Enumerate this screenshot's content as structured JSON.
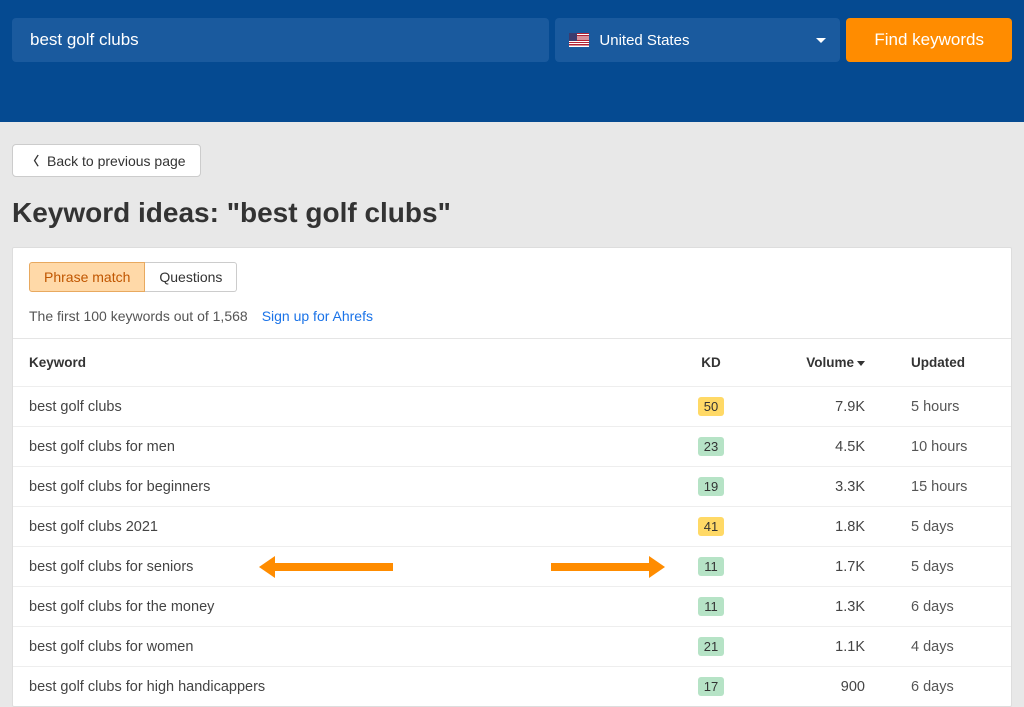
{
  "header": {
    "search_value": "best golf clubs",
    "country": "United States",
    "find_label": "Find keywords"
  },
  "back_label": "Back to previous page",
  "page_title": "Keyword ideas: \"best golf clubs\"",
  "tabs": {
    "phrase": "Phrase match",
    "questions": "Questions"
  },
  "sub_info": {
    "count_text": "The first 100 keywords out of 1,568",
    "signup_link": "Sign up for Ahrefs"
  },
  "columns": {
    "keyword": "Keyword",
    "kd": "KD",
    "volume": "Volume",
    "updated": "Updated"
  },
  "rows": [
    {
      "keyword": "best golf clubs",
      "kd": "50",
      "kd_color": "yellow",
      "volume": "7.9K",
      "updated": "5 hours",
      "highlight": false
    },
    {
      "keyword": "best golf clubs for men",
      "kd": "23",
      "kd_color": "green",
      "volume": "4.5K",
      "updated": "10 hours",
      "highlight": false
    },
    {
      "keyword": "best golf clubs for beginners",
      "kd": "19",
      "kd_color": "green",
      "volume": "3.3K",
      "updated": "15 hours",
      "highlight": false
    },
    {
      "keyword": "best golf clubs 2021",
      "kd": "41",
      "kd_color": "yellow",
      "volume": "1.8K",
      "updated": "5 days",
      "highlight": false
    },
    {
      "keyword": "best golf clubs for seniors",
      "kd": "11",
      "kd_color": "green",
      "volume": "1.7K",
      "updated": "5 days",
      "highlight": true
    },
    {
      "keyword": "best golf clubs for the money",
      "kd": "11",
      "kd_color": "green",
      "volume": "1.3K",
      "updated": "6 days",
      "highlight": false
    },
    {
      "keyword": "best golf clubs for women",
      "kd": "21",
      "kd_color": "green",
      "volume": "1.1K",
      "updated": "4 days",
      "highlight": false
    },
    {
      "keyword": "best golf clubs for high handicappers",
      "kd": "17",
      "kd_color": "green",
      "volume": "900",
      "updated": "6 days",
      "highlight": false
    }
  ]
}
